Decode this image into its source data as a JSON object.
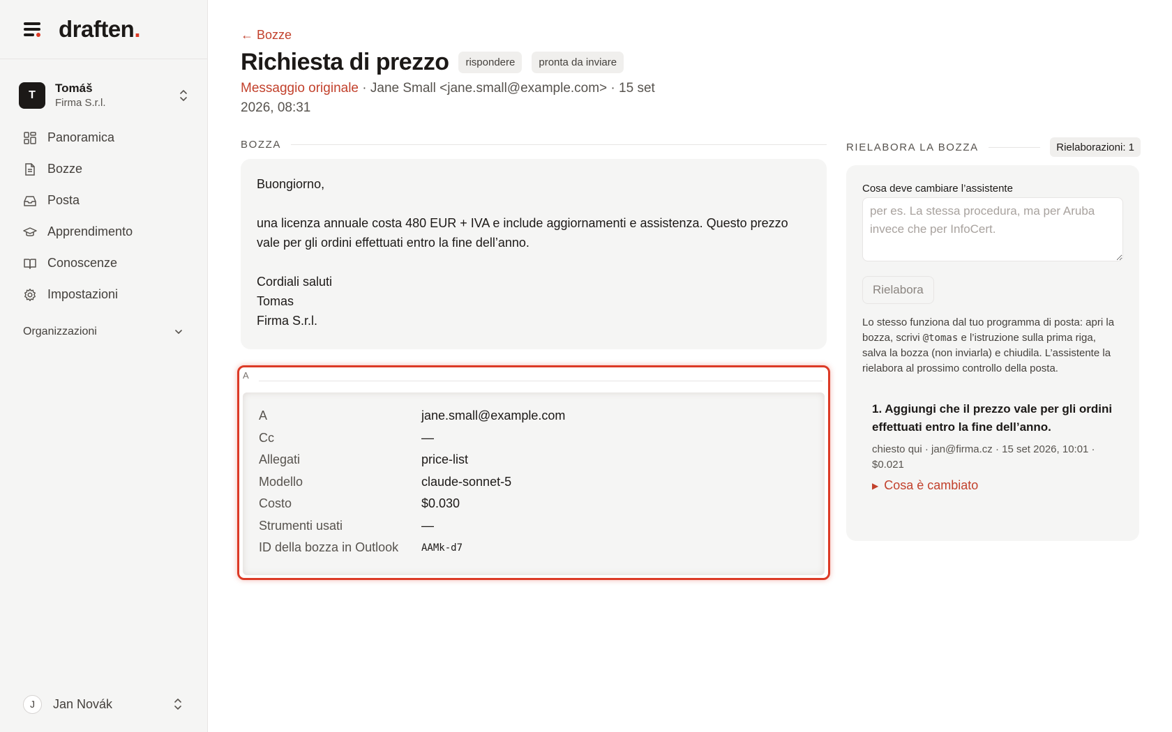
{
  "brand": {
    "name": "draften",
    "dot": "."
  },
  "account": {
    "initial": "T",
    "name": "Tomáš",
    "org": "Firma S.r.l."
  },
  "nav": [
    {
      "label": "Panoramica",
      "icon": "grid-icon"
    },
    {
      "label": "Bozze",
      "icon": "document-icon"
    },
    {
      "label": "Posta",
      "icon": "inbox-icon"
    },
    {
      "label": "Apprendimento",
      "icon": "graduation-cap-icon"
    },
    {
      "label": "Conoscenze",
      "icon": "book-icon"
    },
    {
      "label": "Impostazioni",
      "icon": "gear-icon"
    }
  ],
  "organizations_label": "Organizzazioni",
  "user": {
    "initial": "J",
    "name": "Jan Novák"
  },
  "header": {
    "back_label": "← Bozze",
    "title": "Richiesta di prezzo",
    "badges": [
      "rispondere",
      "pronta da inviare"
    ],
    "original_link": "Messaggio originale",
    "meta_rest": " · Jane Small <jane.small@example.com> · 15 set 2026, 08:31"
  },
  "draft": {
    "section_label": "BOZZA",
    "body": "Buongiorno,\n\nuna licenza annuale costa 480 EUR + IVA e include aggiornamenti e assistenza. Questo prezzo vale per gli ordini effettuati entro la fine dell’anno.\n\nCordiali saluti\nTomas\nFirma S.r.l."
  },
  "details": {
    "section_label": "A",
    "rows": [
      {
        "key": "A",
        "value": "jane.small@example.com"
      },
      {
        "key": "Cc",
        "value": "—"
      },
      {
        "key": "Allegati",
        "value": "price-list"
      },
      {
        "key": "Modello",
        "value": "claude-sonnet-5"
      },
      {
        "key": "Costo",
        "value": "$0.030"
      },
      {
        "key": "Strumenti usati",
        "value": "—"
      },
      {
        "key": "ID della bozza in Outlook",
        "value": "AAMk-d7"
      }
    ]
  },
  "rework": {
    "section_label": "RIELABORA LA BOZZA",
    "count_label": "Rielaborazioni: 1",
    "field_label": "Cosa deve cambiare l’assistente",
    "placeholder": "per es. La stessa procedura, ma per Aruba invece che per InfoCert.",
    "button_label": "Rielabora",
    "help_before": "Lo stesso funziona dal tuo programma di posta: apri la bozza, scrivi ",
    "help_code": "@tomas",
    "help_after": " e l’istruzione sulla prima riga, salva la bozza (non inviarla) e chiudila. L’assistente la rielabora al prossimo controllo della posta.",
    "history": [
      {
        "title": "1. Aggiungi che il prezzo vale per gli ordini effettuati entro la fine dell’anno.",
        "meta": "chiesto qui · jan@firma.cz · 15 set 2026, 10:01 · $0.021",
        "link": "Cosa è cambiato"
      }
    ]
  },
  "colors": {
    "accent": "#c2412c",
    "highlight": "#dc3a26",
    "sidebar_bg": "#f5f5f4"
  }
}
